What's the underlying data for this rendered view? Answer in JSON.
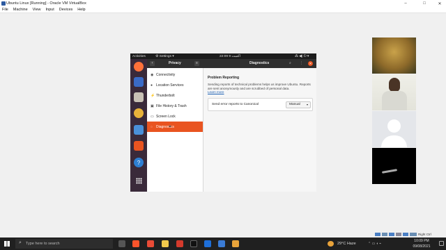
{
  "host": {
    "window_title": "Ubuntu Linux [Running] - Oracle VM VirtualBox",
    "menu": [
      "File",
      "Machine",
      "View",
      "Input",
      "Devices",
      "Help"
    ],
    "min_label": "–",
    "max_label": "□",
    "close_label": "✕"
  },
  "guest": {
    "activities": "Activities",
    "app_menu": "⚙ Settings ▾",
    "clock": "22:09  9 اكست",
    "tray": "⁂ ◀) ⏻ ▾",
    "settings": {
      "sidebar_title": "Privacy",
      "panel_title": "Diagnostics",
      "sidebar_items": [
        {
          "icon": "◉",
          "label": "Connectivity"
        },
        {
          "icon": "●",
          "label": "Location Services"
        },
        {
          "icon": "⚡",
          "label": "Thunderbolt"
        },
        {
          "icon": "▣",
          "label": "File History & Trash"
        },
        {
          "icon": "▭",
          "label": "Screen Lock"
        },
        {
          "icon": "◌",
          "label": "Diagnostics"
        }
      ],
      "section_title": "Problem Reporting",
      "description": "Sending reports of technical problems helps us improve Ubuntu. Reports are sent anonymously and are scrubbed of personal data.",
      "learn_more": "Learn more",
      "send_reports_label": "Send error reports to Canonical",
      "send_reports_value": "Manual",
      "hamburger": "≡",
      "back": "‹",
      "search": "⌕",
      "more": "⋮",
      "close": "✕"
    },
    "dock_help": "?"
  },
  "taskbar": {
    "search_placeholder": "Type here to search",
    "weather": "29°C  Haze",
    "time": "10:09 PM",
    "date": "09/08/2021",
    "host_key": "Right Ctrl"
  }
}
